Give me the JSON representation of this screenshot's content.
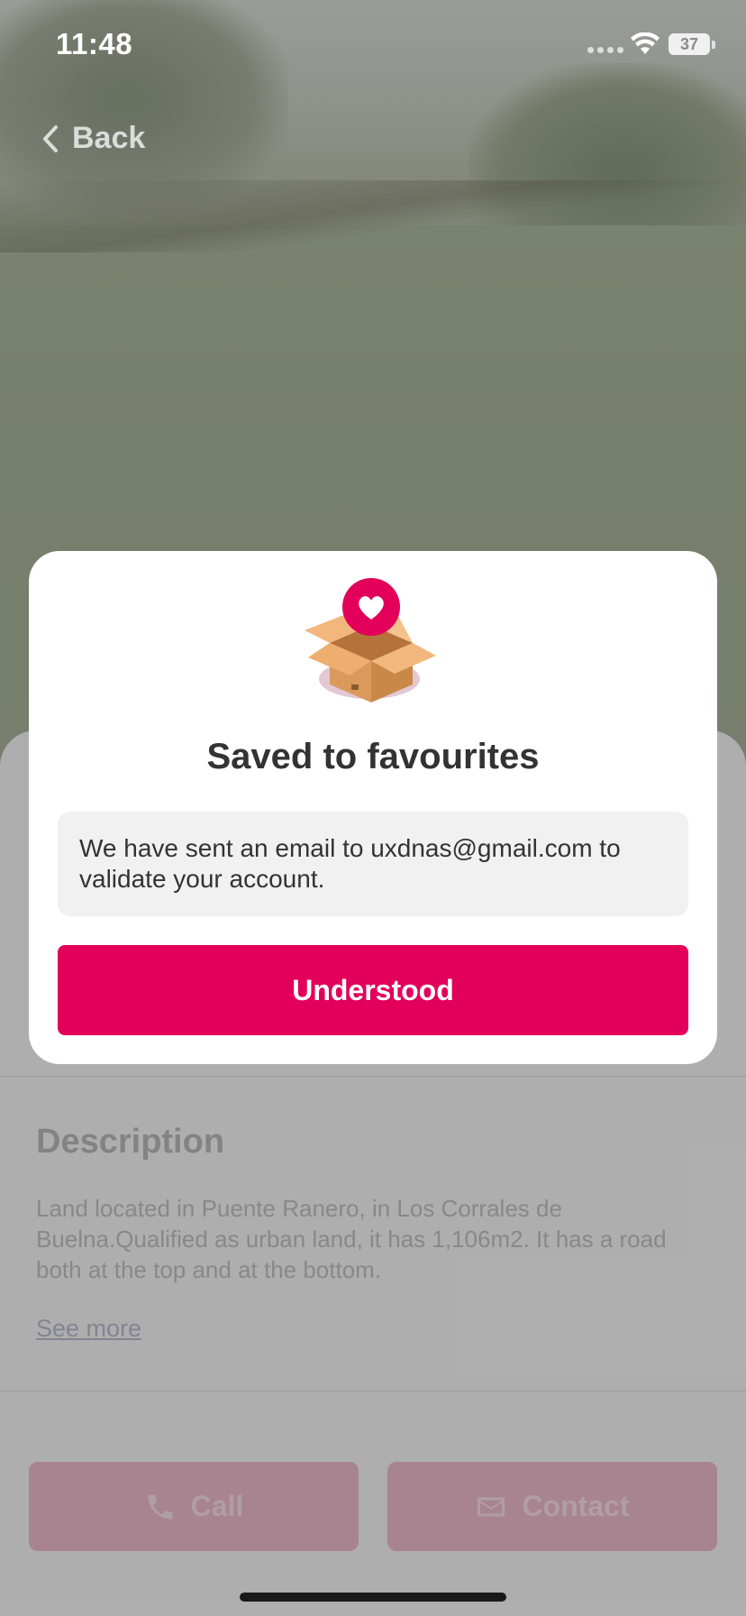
{
  "status_bar": {
    "time": "11:48",
    "battery": "37"
  },
  "nav": {
    "back_label": "Back"
  },
  "modal": {
    "title": "Saved to favourites",
    "message": "We have sent an email to uxdnas@gmail.com to validate your account.",
    "button_label": "Understood",
    "illustration_icon": "open-box-heart-icon"
  },
  "details": {
    "description_heading": "Description",
    "description_text": "Land located in Puente Ranero, in Los Corrales de Buelna.Qualified as urban land, it has 1,106m2. It has a road both at the top and at the bottom.",
    "see_more_label": "See more"
  },
  "actions": {
    "call_label": "Call",
    "contact_label": "Contact"
  },
  "colors": {
    "accent": "#e2005a",
    "text_dark": "#333333"
  }
}
